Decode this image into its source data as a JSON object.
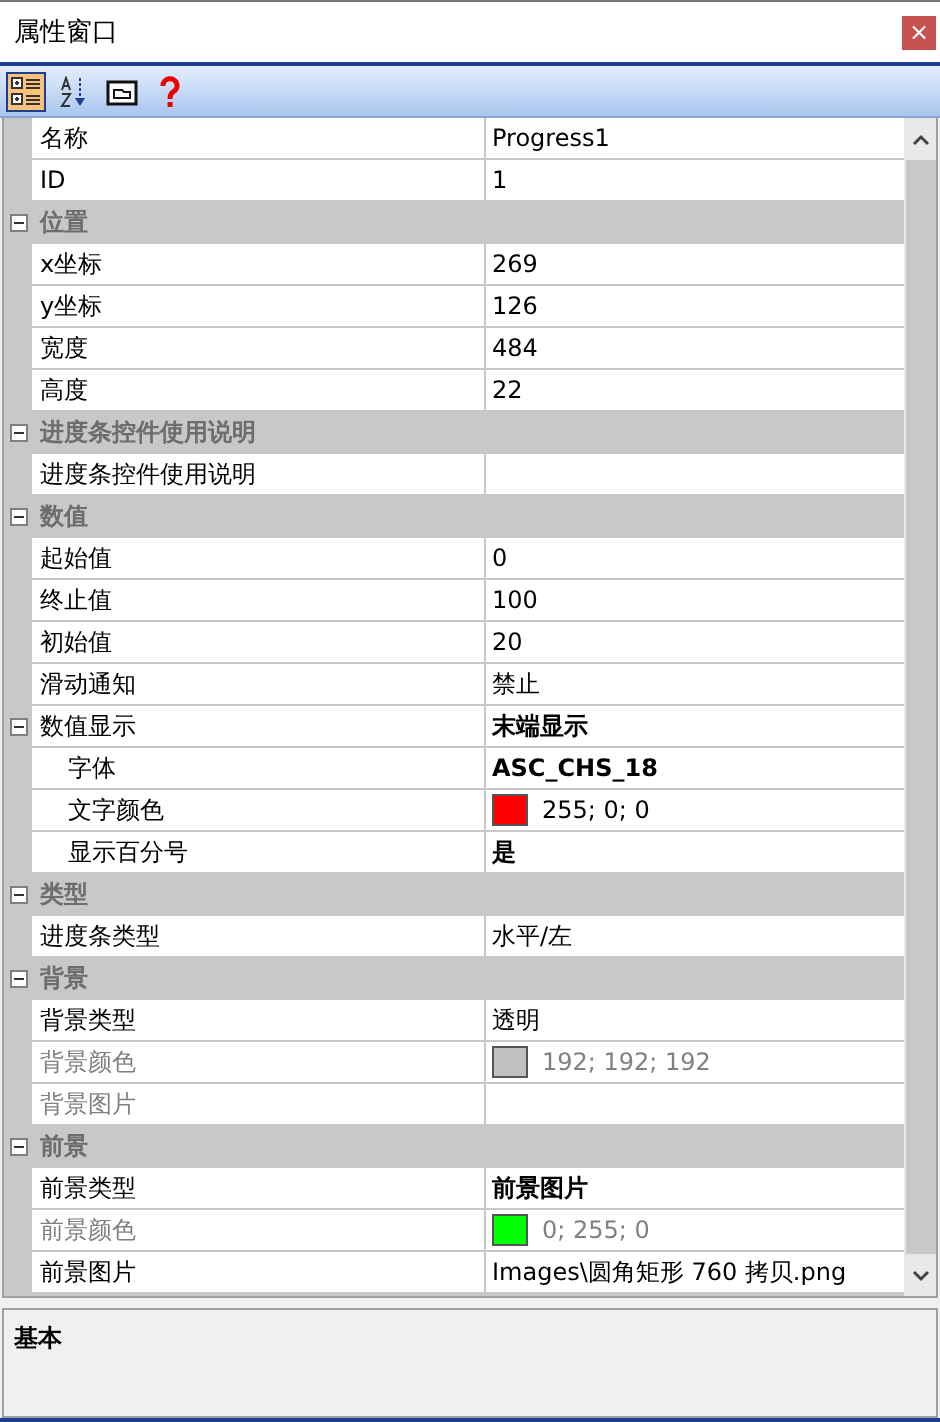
{
  "window": {
    "title": "属性窗口",
    "close": "×"
  },
  "toolbar": [
    {
      "kind": "categorized",
      "selected": true
    },
    {
      "kind": "alphabetical",
      "selected": false
    },
    {
      "kind": "pages",
      "selected": false
    },
    {
      "kind": "help",
      "selected": false
    }
  ],
  "grid": {
    "rows": [
      {
        "name": "名称",
        "value": "Progress1"
      },
      {
        "name": "ID",
        "value": "1"
      }
    ],
    "categories": [
      {
        "title": "位置",
        "expanded": true,
        "rows": [
          {
            "name": "x坐标",
            "value": "269"
          },
          {
            "name": "y坐标",
            "value": "126"
          },
          {
            "name": "宽度",
            "value": "484"
          },
          {
            "name": "高度",
            "value": "22"
          }
        ]
      },
      {
        "title": "进度条控件使用说明",
        "expanded": true,
        "rows": [
          {
            "name": "进度条控件使用说明",
            "value": ""
          }
        ]
      },
      {
        "title": "数值",
        "expanded": true,
        "rows": [
          {
            "name": "起始值",
            "value": "0"
          },
          {
            "name": "终止值",
            "value": "100"
          },
          {
            "name": "初始值",
            "value": "20"
          },
          {
            "name": "滑动通知",
            "value": "禁止"
          },
          {
            "name": "数值显示",
            "value": "末端显示",
            "bold": true,
            "expanded": true,
            "children": [
              {
                "name": "字体",
                "value": "ASC_CHS_18",
                "bold": true
              },
              {
                "name": "文字颜色",
                "value": "255; 0; 0",
                "color": "#ff0000"
              },
              {
                "name": "显示百分号",
                "value": "是",
                "bold": true
              }
            ]
          }
        ]
      },
      {
        "title": "类型",
        "expanded": true,
        "rows": [
          {
            "name": "进度条类型",
            "value": "水平/左"
          }
        ]
      },
      {
        "title": "背景",
        "expanded": true,
        "rows": [
          {
            "name": "背景类型",
            "value": "透明"
          },
          {
            "name": "背景颜色",
            "value": "192; 192; 192",
            "color": "#c0c0c0",
            "disabled": true
          },
          {
            "name": "背景图片",
            "value": "",
            "disabled": true
          }
        ]
      },
      {
        "title": "前景",
        "expanded": true,
        "rows": [
          {
            "name": "前景类型",
            "value": "前景图片",
            "bold": true
          },
          {
            "name": "前景颜色",
            "value": "0; 255; 0",
            "color": "#00ff00",
            "disabled": true
          },
          {
            "name": "前景图片",
            "value": "Images\\圆角矩形 760 拷贝.png"
          }
        ]
      }
    ]
  },
  "description": {
    "title": "基本"
  }
}
